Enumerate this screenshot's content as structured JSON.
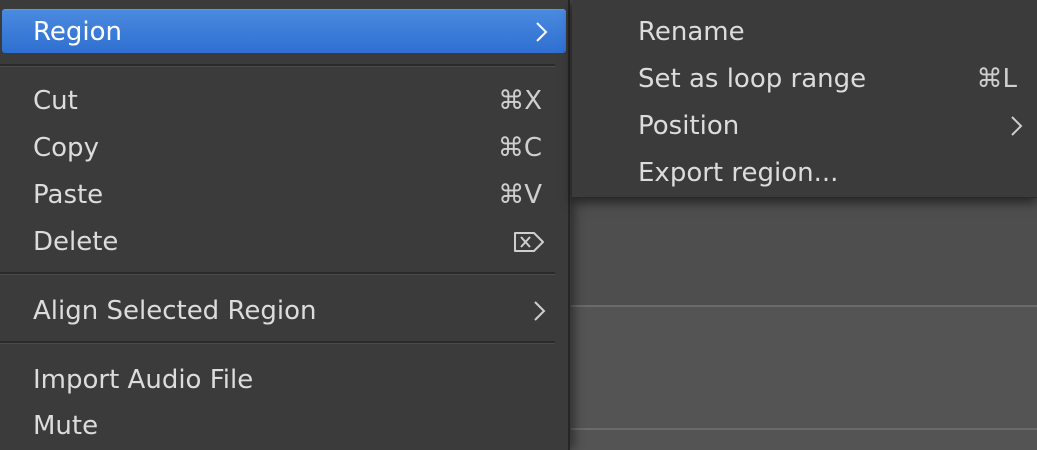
{
  "main_menu": {
    "items": [
      {
        "label": "Region",
        "highlighted": true,
        "has_submenu": true,
        "icon": "chevron-right-icon"
      },
      {
        "label": "Cut",
        "shortcut": "⌘X"
      },
      {
        "label": "Copy",
        "shortcut": "⌘C"
      },
      {
        "label": "Paste",
        "shortcut": "⌘V"
      },
      {
        "label": "Delete",
        "icon": "delete-forward-icon"
      },
      {
        "label": "Align Selected Region",
        "has_submenu": true,
        "icon": "chevron-right-icon"
      },
      {
        "label": "Import Audio File"
      },
      {
        "label": "Mute"
      }
    ]
  },
  "submenu": {
    "items": [
      {
        "label": "Rename"
      },
      {
        "label": "Set as loop range",
        "shortcut": "⌘L"
      },
      {
        "label": "Position",
        "has_submenu": true,
        "icon": "chevron-right-icon"
      },
      {
        "label": "Export region..."
      }
    ]
  },
  "colors": {
    "menu_bg": "#3b3b3b",
    "highlight": "#3d7ed8",
    "text": "#dcdcdc",
    "canvas_bg": "#545454"
  }
}
